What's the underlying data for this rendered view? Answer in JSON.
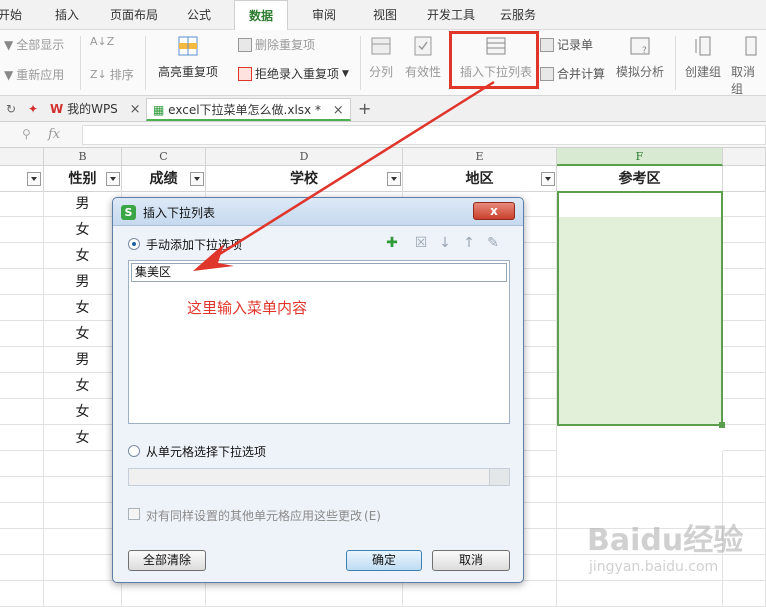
{
  "menu": {
    "tabs": [
      "开始",
      "插入",
      "页面布局",
      "公式",
      "数据",
      "审阅",
      "视图",
      "开发工具",
      "云服务"
    ],
    "active": "数据"
  },
  "ribbon": {
    "show_all": "全部显示",
    "reapply": "重新应用",
    "sort": "排序",
    "highlight_dup": "高亮重复项",
    "delete_dup": "删除重复项",
    "reject_dup": "拒绝录入重复项",
    "split": "分列",
    "validity": "有效性",
    "insert_dropdown": "插入下拉列表",
    "record_sheet": "记录单",
    "consolidate": "合并计算",
    "simulate": "模拟分析",
    "create_group": "创建组",
    "ungroup": "取消组"
  },
  "doctabs": {
    "wps": "我的WPS",
    "file": "excel下拉菜单怎么做.xlsx *"
  },
  "formula": {
    "fx": "fx"
  },
  "sheet": {
    "columns": [
      "B",
      "C",
      "D",
      "E",
      "F"
    ],
    "headers": [
      "性别",
      "成绩",
      "学校",
      "地区",
      "参考区"
    ],
    "gender": [
      "男",
      "女",
      "女",
      "男",
      "女",
      "女",
      "男",
      "女",
      "女",
      "女"
    ]
  },
  "dialog": {
    "title": "插入下拉列表",
    "close": "x",
    "manual_option": "手动添加下拉选项",
    "item_value": "集美区",
    "hint": "这里输入菜单内容",
    "from_cells_option": "从单元格选择下拉选项",
    "apply_same": "对有同样设置的其他单元格应用这些更改",
    "apply_same_key": "(E)",
    "clear_all": "全部清除",
    "ok": "确定",
    "cancel": "取消"
  },
  "watermark": {
    "brand": "Baidu经验",
    "url": "jingyan.baidu.com"
  },
  "colors": {
    "accent_green": "#5a9e4e",
    "annotation_red": "#e0352b"
  }
}
